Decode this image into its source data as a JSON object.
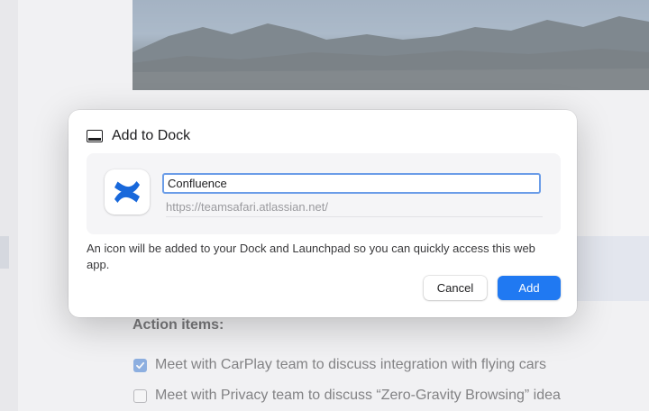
{
  "background": {
    "section_heading": "Action items:",
    "tasks": [
      {
        "label": "Meet with CarPlay team to discuss integration with flying cars",
        "checked": true
      },
      {
        "label": "Meet with Privacy team to discuss “Zero-Gravity Browsing” idea",
        "checked": false
      }
    ]
  },
  "dialog": {
    "title": "Add to Dock",
    "title_icon": "dock-icon",
    "app_icon": "confluence-logo-icon",
    "name_value": "Confluence",
    "url": "https://teamsafari.atlassian.net/",
    "description": "An icon will be added to your Dock and Launchpad so you can quickly access this web app.",
    "cancel_label": "Cancel",
    "add_label": "Add"
  },
  "colors": {
    "accent": "#2079f2",
    "focus_ring": "#6b9de8",
    "confluence_blue": "#1868db",
    "checkbox_checked": "#5b8fd9"
  }
}
